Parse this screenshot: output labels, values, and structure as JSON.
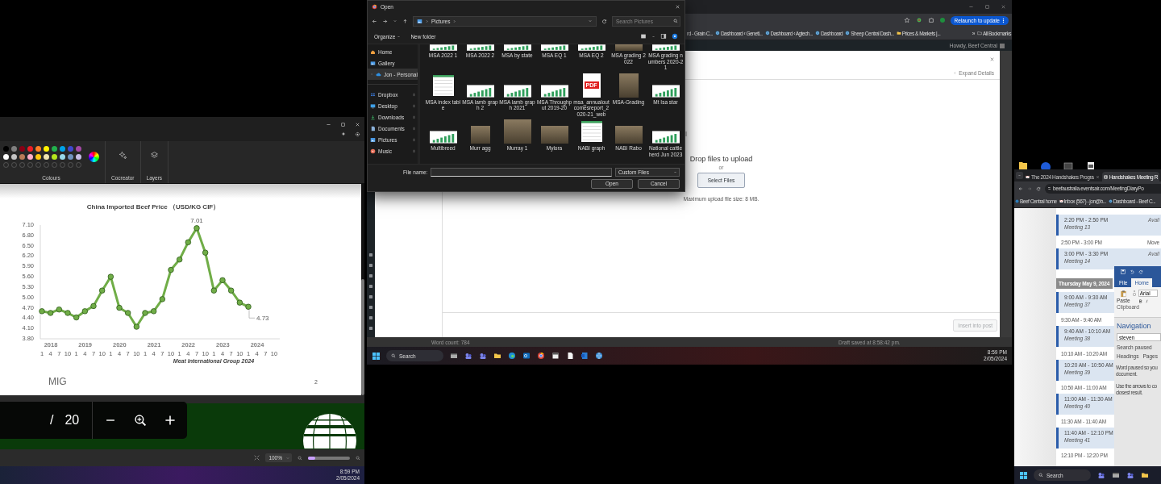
{
  "left_screen": {
    "paint_toolbar": {
      "swatches": [
        {
          "color": "#000000"
        },
        {
          "color": "#7f7f7f"
        },
        {
          "color": "#880015"
        },
        {
          "color": "#ed1c24"
        },
        {
          "color": "#ff7f27"
        },
        {
          "color": "#fff200"
        },
        {
          "color": "#22b14c"
        },
        {
          "color": "#00a2e8"
        },
        {
          "color": "#3f48cc"
        },
        {
          "color": "#a349a4"
        },
        {
          "color": "#ffffff"
        },
        {
          "color": "#c3c3c3"
        },
        {
          "color": "#b97a57"
        },
        {
          "color": "#ffaec9"
        },
        {
          "color": "#ffc90e"
        },
        {
          "color": "#efe4b0"
        },
        {
          "color": "#b5e61d"
        },
        {
          "color": "#99d9ea"
        },
        {
          "color": "#7092be"
        },
        {
          "color": "#c8bfe7"
        }
      ],
      "colours_label": "Colours",
      "tools": [
        {
          "kind": "sparkle",
          "label": "Cocreator"
        },
        {
          "kind": "layers",
          "label": "Layers"
        }
      ]
    },
    "slide": {
      "chart": {
        "chart_data": {
          "type": "line",
          "title": "China Imported Beef Price （USD/KG CIF）",
          "categories": [
            "1",
            "4",
            "7",
            "10",
            "1",
            "4",
            "7",
            "10",
            "1",
            "4",
            "7",
            "10",
            "1",
            "4",
            "7",
            "10",
            "1",
            "4",
            "7",
            "10",
            "1",
            "4",
            "7",
            "10",
            "1",
            "4",
            "7",
            "10"
          ],
          "series": [
            {
              "color": "#70ad47",
              "marker": "circle",
              "values": [
                4.6,
                4.55,
                4.65,
                4.55,
                4.42,
                4.6,
                4.75,
                5.2,
                5.6,
                4.7,
                4.55,
                4.15,
                4.55,
                4.6,
                4.95,
                5.8,
                6.1,
                6.6,
                7.01,
                6.3,
                5.2,
                5.5,
                5.2,
                4.85,
                4.73,
                null,
                null,
                null
              ]
            }
          ],
          "ylim": [
            3.8,
            7.1
          ],
          "yticks": [
            {
              "value": 3.8,
              "label": "3.80"
            },
            {
              "value": 4.1,
              "label": "4.10"
            },
            {
              "value": 4.4,
              "label": "4.40"
            },
            {
              "value": 4.7,
              "label": "4.70"
            },
            {
              "value": 5.0,
              "label": "5.00"
            },
            {
              "value": 5.3,
              "label": "5.30"
            },
            {
              "value": 5.6,
              "label": "5.60"
            },
            {
              "value": 5.9,
              "label": "5.90"
            },
            {
              "value": 6.2,
              "label": "6.20"
            },
            {
              "value": 6.5,
              "label": "6.50"
            },
            {
              "value": 6.8,
              "label": "6.80"
            },
            {
              "value": 7.1,
              "label": "7.10"
            }
          ],
          "annotations": [
            {
              "y": 7.01,
              "text": "7.01"
            },
            "4.73"
          ]
        },
        "year_labels": [
          "2018",
          "2019",
          "2020",
          "2021",
          "2022",
          "2023",
          "2024"
        ],
        "source_note": "Meat International Group 2024"
      },
      "footer": "MIG",
      "page_number": "2"
    },
    "viewer_controls": {
      "page_separator": "/",
      "page_total": "20"
    },
    "status_bar": {
      "zoom": "100%",
      "zoom_slider": {
        "level": 0.17
      }
    },
    "taskbar": {
      "time": "8:59 PM",
      "date": "2/05/2024"
    }
  },
  "middle_screen": {
    "browser": {
      "bookmarks": [
        "rd - Grain C...",
        "Dashboard ‹ Geneti...",
        "Dashboard ‹ Agtech...",
        "Dashboard",
        "Sheep Central Dash...",
        "Prices & Markets |..."
      ],
      "more": "»",
      "all_bookmarks": "All Bookmarks",
      "relaunch_button": "Relaunch to update",
      "admin_greeting": "Howdy, Beef Central"
    },
    "dialog": {
      "title": "Open",
      "path": "Pictures",
      "search_placeholder": "Search Pictures",
      "organize": "Organize",
      "new_folder": "New folder",
      "nav_items": [
        {
          "kind": "home",
          "label": "Home",
          "pinned": false,
          "selected": false
        },
        {
          "kind": "gallery",
          "label": "Gallery",
          "pinned": false,
          "selected": false
        },
        {
          "kind": "cloud",
          "label": "Jon - Personal",
          "pinned": false,
          "selected": true
        },
        {
          "kind": "dropbox",
          "label": "Dropbox",
          "pinned": true,
          "selected": false
        },
        {
          "kind": "desktop",
          "label": "Desktop",
          "pinned": true,
          "selected": false
        },
        {
          "kind": "downloads",
          "label": "Downloads",
          "pinned": true,
          "selected": false
        },
        {
          "kind": "documents",
          "label": "Documents",
          "pinned": true,
          "selected": false
        },
        {
          "kind": "pictures",
          "label": "Pictures",
          "pinned": true,
          "selected": false
        },
        {
          "kind": "music",
          "label": "Music",
          "pinned": true,
          "selected": false
        }
      ],
      "files": [
        {
          "kind": "chart",
          "name": "MSA 2022 1"
        },
        {
          "kind": "chart",
          "name": "MSA 2022 2"
        },
        {
          "kind": "chart",
          "name": "MSA by state"
        },
        {
          "kind": "chart",
          "name": "MSA EQ 1"
        },
        {
          "kind": "chart",
          "name": "MSA EQ 2"
        },
        {
          "kind": "photo",
          "name": "MSA grading 2022"
        },
        {
          "kind": "chart",
          "name": "MSA grading numbers 2020-21"
        },
        {
          "kind": "table",
          "name": "MSA index table"
        },
        {
          "kind": "chart",
          "name": "MSA lamb graph 2"
        },
        {
          "kind": "chart",
          "name": "MSA lamb graph 2021"
        },
        {
          "kind": "chart",
          "name": "MSA Throughput 2019-20"
        },
        {
          "kind": "pdf",
          "name": "msa_annualoutcomesreport_2020-21_web",
          "badge": "PDF"
        },
        {
          "kind": "photo",
          "name": "MSA-Grading"
        },
        {
          "kind": "chart",
          "name": "Mt Isa star"
        },
        {
          "kind": "chart",
          "name": "Multibreed"
        },
        {
          "kind": "photo",
          "name": "Murr agg"
        },
        {
          "kind": "photo",
          "name": "Murray 1"
        },
        {
          "kind": "photo",
          "name": "Mylora"
        },
        {
          "kind": "table",
          "name": "NABI graph"
        },
        {
          "kind": "photo",
          "name": "NABI Rabo"
        },
        {
          "kind": "chart",
          "name": "National cattle herd Jun 2023"
        }
      ],
      "file_name_label": "File name:",
      "file_type": "Custom Files",
      "buttons": [
        "Open",
        "Cancel"
      ]
    },
    "media_modal": {
      "expand_details": "Expand Details",
      "drop_text": "Drop files to upload",
      "or": "or",
      "select_button": "Select Files",
      "max_size": "Maximum upload file size: 8 MB.",
      "insert_button": {
        "label": "Insert into post",
        "disabled": true
      }
    },
    "editor_footer": {
      "word_count": "Word count: 784",
      "draft_status": "Draft saved at 8:58:42 pm."
    },
    "taskbar": {
      "search": "Search",
      "time": "8:59 PM",
      "date": "2/05/2024"
    }
  },
  "right_screen": {
    "browser": {
      "tabs": [
        {
          "label": "The 2024 Handshakes Progra",
          "selected": false
        },
        {
          "label": "Handshakes Meeting R",
          "selected": true
        }
      ],
      "url": "beefaustralia.eventsair.com/MeetingDiaryPo",
      "bookmarks": [
        "Beef Central home",
        "Inbox (567) - jon@b...",
        "Dashboard - Beef C..."
      ]
    },
    "schedule": [
      {
        "kind": "meeting",
        "time": "2:20 PM - 2:50 PM",
        "title": "Meeting 13",
        "status": "Avail"
      },
      {
        "kind": "break",
        "time": "2:50 PM - 3:00 PM",
        "status": "Move"
      },
      {
        "kind": "meeting",
        "time": "3:00 PM - 3:30 PM",
        "title": "Meeting 14",
        "status": "Avail"
      },
      {
        "kind": "day",
        "time": "Thursday May 9, 2024"
      },
      {
        "kind": "meeting",
        "time": "9:00 AM - 9:30 AM",
        "title": "Meeting 37"
      },
      {
        "kind": "break",
        "time": "9:30 AM - 9:40 AM"
      },
      {
        "kind": "meeting",
        "time": "9:40 AM - 10:10 AM",
        "title": "Meeting 38"
      },
      {
        "kind": "break",
        "time": "10:10 AM - 10:20 AM"
      },
      {
        "kind": "meeting",
        "time": "10:20 AM - 10:50 AM",
        "title": "Meeting 39"
      },
      {
        "kind": "break",
        "time": "10:50 AM - 11:00 AM"
      },
      {
        "kind": "meeting",
        "time": "11:00 AM - 11:30 AM",
        "title": "Meeting 40"
      },
      {
        "kind": "break",
        "time": "11:30 AM - 11:40 AM"
      },
      {
        "kind": "meeting",
        "time": "11:40 AM - 12:10 PM",
        "title": "Meeting 41"
      },
      {
        "kind": "break",
        "time": "12:10 PM - 12:20 PM"
      }
    ],
    "word": {
      "tabs": [
        {
          "label": "File",
          "selected": false
        },
        {
          "label": "Home",
          "selected": true
        }
      ],
      "font": "Arial",
      "paste": "Paste",
      "clipboard": "Clipboard",
      "nav_title": "Navigation",
      "search_value": "steven",
      "search_status": "Search paused",
      "nav_tabs": [
        "Headings",
        "Pages"
      ],
      "messages": [
        {
          "lines": [
            "Word paused so you",
            "document."
          ]
        },
        {
          "lines": [
            "Use the arrows to co",
            "closest result."
          ]
        }
      ]
    },
    "taskbar": {
      "search": "Search"
    }
  }
}
